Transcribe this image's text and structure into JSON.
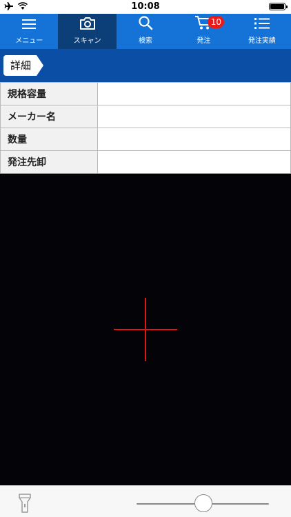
{
  "status_bar": {
    "time": "10:08"
  },
  "tabs": [
    {
      "label": "メニュー",
      "icon": "menu-icon"
    },
    {
      "label": "スキャン",
      "icon": "camera-icon",
      "active": true
    },
    {
      "label": "検索",
      "icon": "search-icon"
    },
    {
      "label": "発注",
      "icon": "cart-icon",
      "badge": "10"
    },
    {
      "label": "発注実績",
      "icon": "list-icon"
    }
  ],
  "detail": {
    "tag_label": "詳細"
  },
  "info_rows": [
    {
      "label": "規格容量",
      "value": ""
    },
    {
      "label": "メーカー名",
      "value": ""
    },
    {
      "label": "数量",
      "value": ""
    },
    {
      "label": "発注先卸",
      "value": ""
    }
  ],
  "colors": {
    "tab_bar": "#1573d8",
    "tab_active": "#0c3f78",
    "header": "#0a4ea5",
    "crosshair": "#e01515",
    "badge": "#e81a1a"
  },
  "zoom_slider": {
    "level": 0.5
  }
}
